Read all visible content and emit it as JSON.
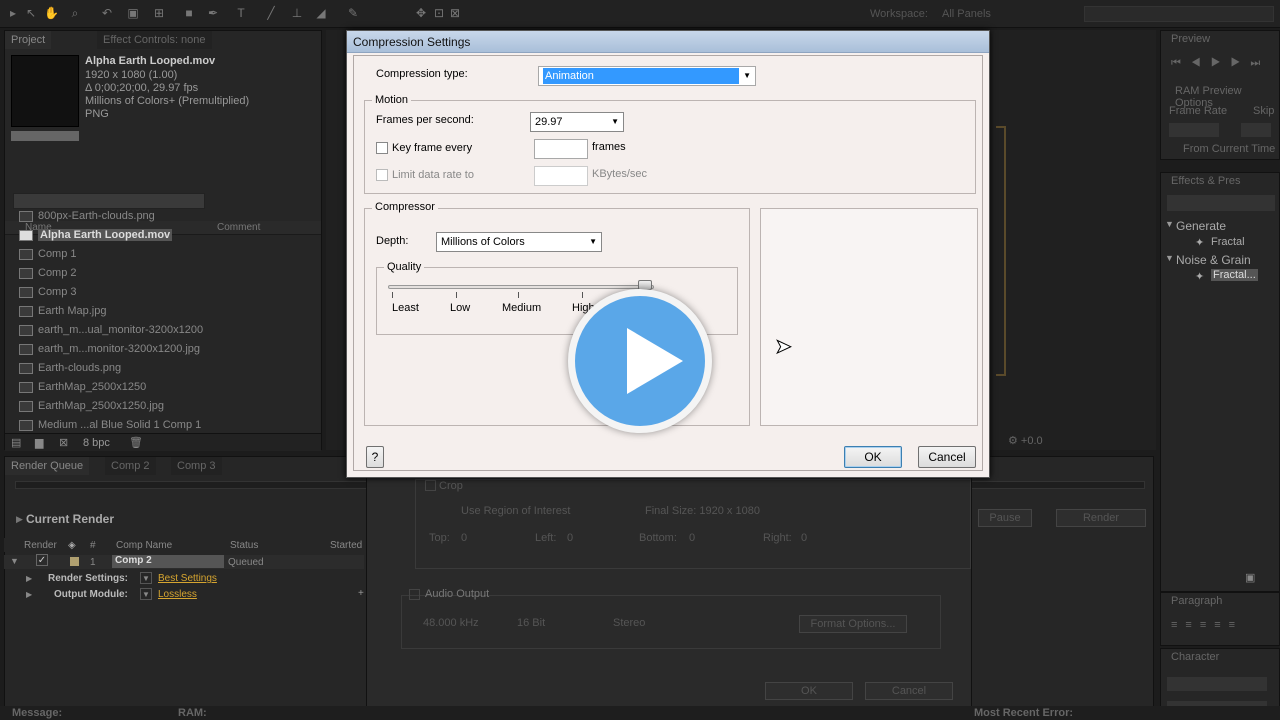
{
  "toolbar": {
    "workspace_label": "Workspace:",
    "workspace_value": "All Panels"
  },
  "project": {
    "tab_project": "Project",
    "tab_effects": "Effect Controls: none",
    "file_name": "Alpha Earth Looped.mov",
    "file_dims": "1920 x 1080 (1.00)",
    "file_duration": "Δ 0;00;20;00, 29.97 fps",
    "file_colors": "Millions of Colors+ (Premultiplied)",
    "file_codec": "PNG",
    "col_name": "Name",
    "col_comment": "Comment",
    "items": [
      "800px-Earth-clouds.png",
      "Alpha Earth Looped.mov",
      "Comp 1",
      "Comp 2",
      "Comp 3",
      "Earth Map.jpg",
      "earth_m...ual_monitor-3200x1200",
      "earth_m...monitor-3200x1200.jpg",
      "Earth-clouds.png",
      "EarthMap_2500x1250",
      "EarthMap_2500x1250.jpg",
      "Medium ...al Blue Solid  1 Comp 1"
    ],
    "bpc": "8 bpc"
  },
  "render_queue": {
    "tab_rq": "Render Queue",
    "tab_comp2": "Comp 2",
    "tab_comp3": "Comp 3",
    "current_render": "Current Render",
    "hdr_render": "Render",
    "hdr_num": "#",
    "hdr_comp": "Comp Name",
    "hdr_status": "Status",
    "hdr_started": "Started",
    "row_num": "1",
    "row_comp": "Comp 2",
    "row_status": "Queued",
    "render_settings_label": "Render Settings:",
    "render_settings_value": "Best Settings",
    "output_module_label": "Output Module:",
    "output_module_value": "Lossless",
    "pause": "Pause",
    "render": "Render",
    "message": "Message:",
    "ram": "RAM:",
    "most_recent_error": "Most Recent Error:"
  },
  "output_module": {
    "crop": "Crop",
    "use_roi": "Use Region of Interest",
    "final_size": "Final Size: 1920 x 1080",
    "top": "Top:",
    "top_v": "0",
    "left": "Left:",
    "left_v": "0",
    "bottom": "Bottom:",
    "bottom_v": "0",
    "right": "Right:",
    "right_v": "0",
    "audio_output": "Audio Output",
    "khz": "48.000 kHz",
    "bit": "16 Bit",
    "stereo": "Stereo",
    "format_options": "Format Options...",
    "ok": "OK",
    "cancel": "Cancel"
  },
  "right_panels": {
    "preview": "Preview",
    "ram_preview": "RAM Preview Options",
    "frame_rate": "Frame Rate",
    "skip": "Skip",
    "from_current": "From Current Time",
    "effects_presets": "Effects & Pres",
    "generate": "Generate",
    "fractal1": "Fractal",
    "noise_grain": "Noise & Grain",
    "fractal2": "Fractal...",
    "paragraph": "Paragraph",
    "character": "Character"
  },
  "dialog": {
    "title": "Compression Settings",
    "compression_type_label": "Compression type:",
    "compression_type_value": "Animation",
    "motion": "Motion",
    "fps_label": "Frames per second:",
    "fps_value": "29.97",
    "key_frame_label": "Key frame every",
    "frames": "frames",
    "limit_label": "Limit data rate to",
    "kbytes": "KBytes/sec",
    "compressor": "Compressor",
    "depth_label": "Depth:",
    "depth_value": "Millions of Colors",
    "quality": "Quality",
    "q_least": "Least",
    "q_low": "Low",
    "q_medium": "Medium",
    "q_high": "High",
    "help": "?",
    "ok": "OK",
    "cancel": "Cancel"
  },
  "colors": {
    "accent": "#5aa7e8",
    "selection": "#3399ff",
    "link": "#d6a530"
  }
}
